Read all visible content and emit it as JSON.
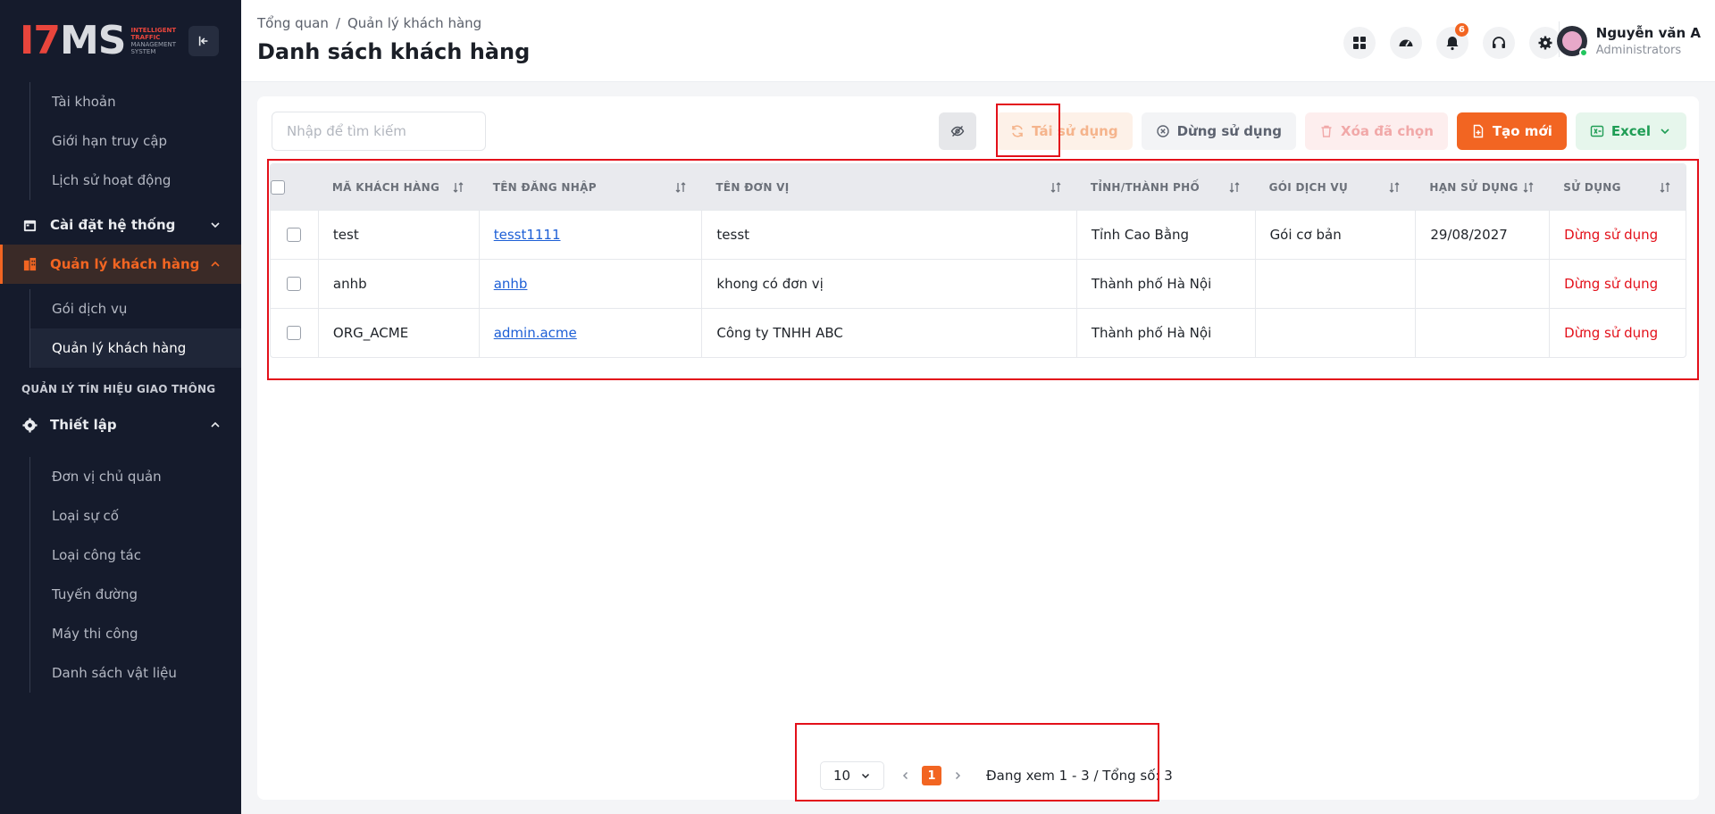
{
  "colors": {
    "accent": "#f26522",
    "sidebar_bg": "#151b2c",
    "highlight_red": "#e3101a",
    "link": "#1d5fd6"
  },
  "logo": {
    "mark_prefix": "I7",
    "mark_suffix": "MS",
    "sub_line1": "INTELLIGENT",
    "sub_line2": "TRAFFIC",
    "sub_line3": "MANAGEMENT",
    "sub_line4": "SYSTEM"
  },
  "sidebar": {
    "group1": [
      "Tài khoản",
      "Giới hạn truy cập",
      "Lịch sử hoạt động"
    ],
    "settings_label": "Cài đặt hệ thống",
    "customers_label": "Quản lý khách hàng",
    "group2": [
      "Gói dịch vụ",
      "Quản lý khách hàng"
    ],
    "section_title": "QUẢN LÝ TÍN HIỆU GIAO THÔNG",
    "setup_label": "Thiết lập",
    "group3": [
      "Đơn vị chủ quản",
      "Loại sự cố",
      "Loại công tác",
      "Tuyến đường",
      "Máy thi công",
      "Danh sách vật liệu"
    ]
  },
  "header": {
    "breadcrumb_home": "Tổng quan",
    "breadcrumb_sep": "/",
    "breadcrumb_current": "Quản lý khách hàng",
    "title": "Danh sách khách hàng",
    "notif_count": "6",
    "user_name": "Nguyễn văn A",
    "user_role": "Administrators"
  },
  "toolbar": {
    "search_placeholder": "Nhập để tìm kiếm",
    "reuse_label": "Tái sử dụng",
    "stop_label": "Dừng sử dụng",
    "delete_label": "Xóa đã chọn",
    "create_label": "Tạo mới",
    "excel_label": "Excel"
  },
  "table": {
    "headers": [
      "MÃ KHÁCH HÀNG",
      "TÊN ĐĂNG NHẬP",
      "TÊN ĐƠN VỊ",
      "TỈNH/THÀNH PHỐ",
      "GÓI DỊCH VỤ",
      "HẠN SỬ DỤNG",
      "SỬ DỤNG"
    ],
    "rows": [
      [
        "test",
        "tesst1111",
        "tesst",
        "Tỉnh Cao Bằng",
        "Gói cơ bản",
        "29/08/2027",
        "Dừng sử dụng"
      ],
      [
        "anhb",
        "anhb",
        "khong có đơn vị",
        "Thành phố Hà Nội",
        "",
        "",
        "Dừng sử dụng"
      ],
      [
        "ORG_ACME",
        "admin.acme",
        "Công ty TNHH ABC",
        "Thành phố Hà Nội",
        "",
        "",
        "Dừng sử dụng"
      ]
    ]
  },
  "pagination": {
    "page_size": "10",
    "current_page": "1",
    "info": "Đang xem 1 - 3 / Tổng số: 3"
  }
}
